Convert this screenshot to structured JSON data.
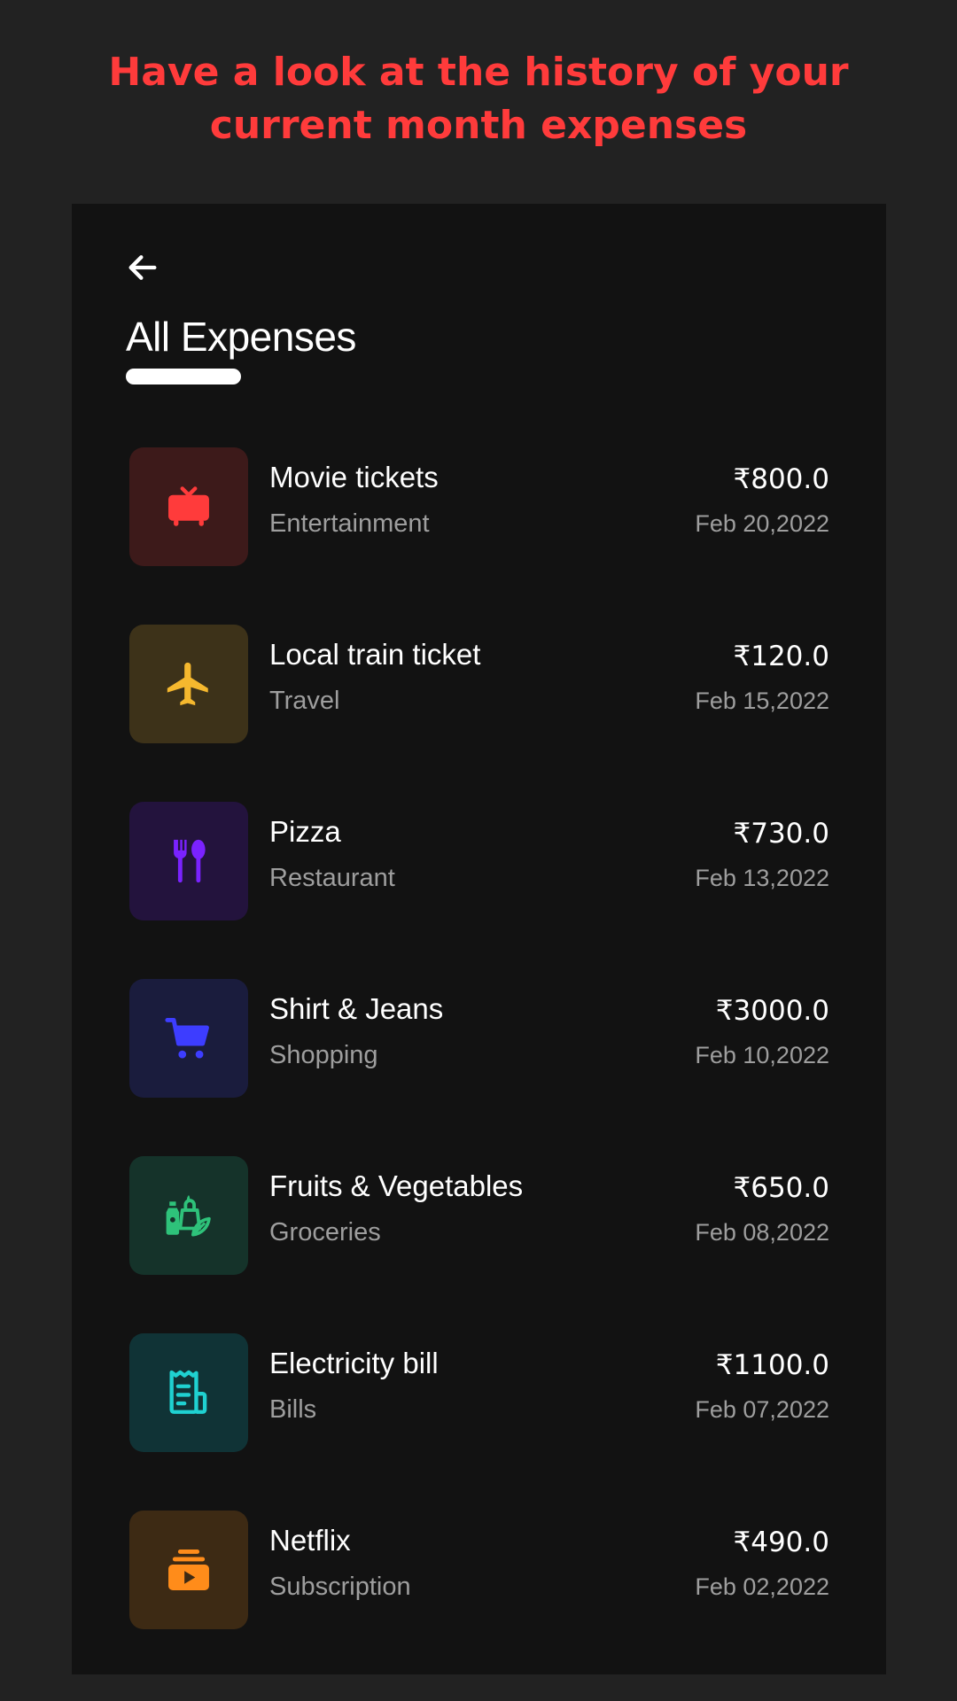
{
  "headline": {
    "line1": "Have a look at the history of your",
    "line2": "current month expenses"
  },
  "screen": {
    "title": "All Expenses",
    "back_icon": "arrow-left-icon"
  },
  "colors": {
    "background": "#222222",
    "screen_background": "#121212",
    "headline": "#ff3b3b"
  },
  "expenses": [
    {
      "name": "Movie tickets",
      "category": "Entertainment",
      "amount": "₹800.0",
      "date": "Feb 20,2022",
      "icon": "tv-icon",
      "icon_color": "#ff3b3b",
      "tile_color": "#3d1a1a"
    },
    {
      "name": "Local train ticket",
      "category": "Travel",
      "amount": "₹120.0",
      "date": "Feb 15,2022",
      "icon": "airplane-icon",
      "icon_color": "#f5b82e",
      "tile_color": "#3d3219"
    },
    {
      "name": "Pizza",
      "category": "Restaurant",
      "amount": "₹730.0",
      "date": "Feb 13,2022",
      "icon": "fork-spoon-icon",
      "icon_color": "#7a22ff",
      "tile_color": "#23133d"
    },
    {
      "name": "Shirt & Jeans",
      "category": "Shopping",
      "amount": "₹3000.0",
      "date": "Feb 10,2022",
      "icon": "shopping-cart-icon",
      "icon_color": "#3d3dff",
      "tile_color": "#1a1c3d"
    },
    {
      "name": "Fruits & Vegetables",
      "category": "Groceries",
      "amount": "₹650.0",
      "date": "Feb 08,2022",
      "icon": "grocery-bag-icon",
      "icon_color": "#2ec27a",
      "tile_color": "#15332a"
    },
    {
      "name": "Electricity bill",
      "category": "Bills",
      "amount": "₹1100.0",
      "date": "Feb 07,2022",
      "icon": "receipt-icon",
      "icon_color": "#1fd1d1",
      "tile_color": "#103336"
    },
    {
      "name": "Netflix",
      "category": "Subscription",
      "amount": "₹490.0",
      "date": "Feb 02,2022",
      "icon": "subscription-play-icon",
      "icon_color": "#ff8c1a",
      "tile_color": "#3d2a14"
    }
  ]
}
